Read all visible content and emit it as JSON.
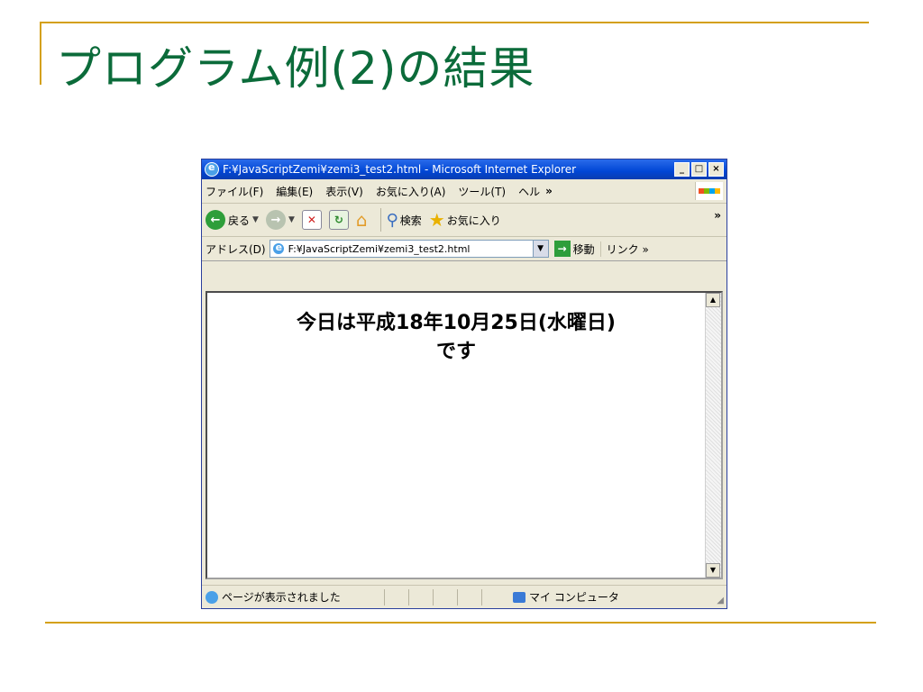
{
  "slide": {
    "title": "プログラム例(2)の結果"
  },
  "window": {
    "title": "F:¥JavaScriptZemi¥zemi3_test2.html - Microsoft Internet Explorer",
    "min_label": "_",
    "max_label": "□",
    "close_label": "×"
  },
  "menu": {
    "items": [
      "ファイル(F)",
      "編集(E)",
      "表示(V)",
      "お気に入り(A)",
      "ツール(T)",
      "ヘル"
    ],
    "more": "»"
  },
  "toolbar": {
    "back_label": "戻る",
    "search_label": "検索",
    "favorites_label": "お気に入り",
    "more": "»"
  },
  "address": {
    "label": "アドレス(D)",
    "value": "F:¥JavaScriptZemi¥zemi3_test2.html",
    "go_label": "移動",
    "links_label": "リンク »"
  },
  "page": {
    "line1": "今日は平成18年10月25日(水曜日)",
    "line2": "です"
  },
  "status": {
    "text": "ページが表示されました",
    "zone": "マイ コンピュータ"
  },
  "colors": {
    "title_green": "#0b6b3a",
    "rule_gold": "#d4a017",
    "titlebar_blue": "#0046d5"
  }
}
